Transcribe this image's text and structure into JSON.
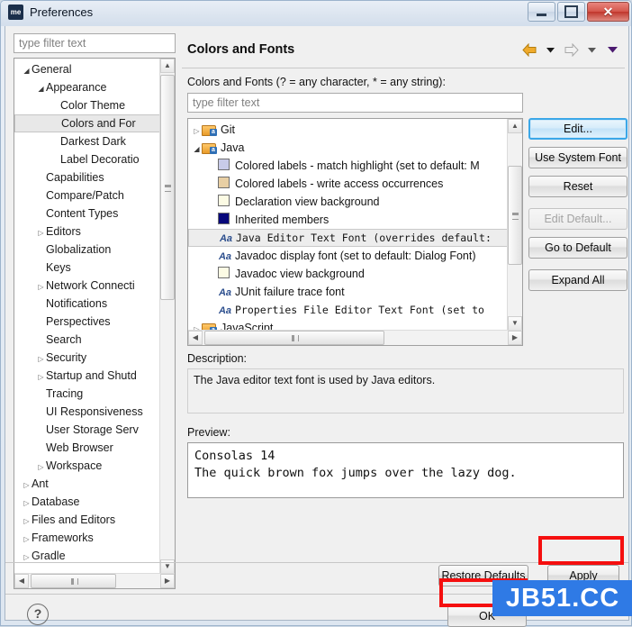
{
  "window": {
    "title": "Preferences",
    "app_icon_text": "me",
    "controls": {
      "minimize": "minimize-icon",
      "maximize": "maximize-icon",
      "close": "✕"
    }
  },
  "left": {
    "filter_placeholder": "type filter text",
    "tree": [
      {
        "label": "General",
        "indent": 0,
        "arrow": "open",
        "selected": false
      },
      {
        "label": "Appearance",
        "indent": 1,
        "arrow": "open",
        "selected": false
      },
      {
        "label": "Color Theme",
        "indent": 2,
        "arrow": "none",
        "selected": false
      },
      {
        "label": "Colors and For",
        "indent": 2,
        "arrow": "none",
        "selected": true
      },
      {
        "label": "Darkest Dark",
        "indent": 2,
        "arrow": "none",
        "selected": false
      },
      {
        "label": "Label Decoratio",
        "indent": 2,
        "arrow": "none",
        "selected": false
      },
      {
        "label": "Capabilities",
        "indent": 1,
        "arrow": "none",
        "selected": false
      },
      {
        "label": "Compare/Patch",
        "indent": 1,
        "arrow": "none",
        "selected": false
      },
      {
        "label": "Content Types",
        "indent": 1,
        "arrow": "none",
        "selected": false
      },
      {
        "label": "Editors",
        "indent": 1,
        "arrow": "closed",
        "selected": false
      },
      {
        "label": "Globalization",
        "indent": 1,
        "arrow": "none",
        "selected": false
      },
      {
        "label": "Keys",
        "indent": 1,
        "arrow": "none",
        "selected": false
      },
      {
        "label": "Network Connecti",
        "indent": 1,
        "arrow": "closed",
        "selected": false
      },
      {
        "label": "Notifications",
        "indent": 1,
        "arrow": "none",
        "selected": false
      },
      {
        "label": "Perspectives",
        "indent": 1,
        "arrow": "none",
        "selected": false
      },
      {
        "label": "Search",
        "indent": 1,
        "arrow": "none",
        "selected": false
      },
      {
        "label": "Security",
        "indent": 1,
        "arrow": "closed",
        "selected": false
      },
      {
        "label": "Startup and Shutd",
        "indent": 1,
        "arrow": "closed",
        "selected": false
      },
      {
        "label": "Tracing",
        "indent": 1,
        "arrow": "none",
        "selected": false
      },
      {
        "label": "UI Responsiveness",
        "indent": 1,
        "arrow": "none",
        "selected": false
      },
      {
        "label": "User Storage Serv",
        "indent": 1,
        "arrow": "none",
        "selected": false
      },
      {
        "label": "Web Browser",
        "indent": 1,
        "arrow": "none",
        "selected": false
      },
      {
        "label": "Workspace",
        "indent": 1,
        "arrow": "closed",
        "selected": false
      },
      {
        "label": "Ant",
        "indent": 0,
        "arrow": "closed",
        "selected": false
      },
      {
        "label": "Database",
        "indent": 0,
        "arrow": "closed",
        "selected": false
      },
      {
        "label": "Files and Editors",
        "indent": 0,
        "arrow": "closed",
        "selected": false
      },
      {
        "label": "Frameworks",
        "indent": 0,
        "arrow": "closed",
        "selected": false
      },
      {
        "label": "Gradle",
        "indent": 0,
        "arrow": "closed",
        "selected": false
      }
    ]
  },
  "page": {
    "title": "Colors and Fonts",
    "nav": {
      "back": "back-arrow-icon",
      "back_menu": "chevron-down-icon",
      "forward": "forward-arrow-icon",
      "forward_menu": "chevron-down-icon",
      "view_menu": "view-menu-icon"
    },
    "filter_label": "Colors and Fonts (? = any character, * = any string):",
    "filter_placeholder": "type filter text",
    "tree": [
      {
        "label": "Git",
        "kind": "folder",
        "indent": 0,
        "arrow": "closed",
        "selected": false
      },
      {
        "label": "Java",
        "kind": "folder",
        "indent": 0,
        "arrow": "open",
        "selected": false
      },
      {
        "label": "Colored labels - match highlight (set to default: M",
        "kind": "swatch",
        "color": "#c8cbe8",
        "indent": 1,
        "arrow": "none",
        "selected": false
      },
      {
        "label": "Colored labels - write access occurrences",
        "kind": "swatch",
        "color": "#e8cfa4",
        "indent": 1,
        "arrow": "none",
        "selected": false
      },
      {
        "label": "Declaration view background",
        "kind": "swatch",
        "color": "#fcfbe4",
        "indent": 1,
        "arrow": "none",
        "selected": false
      },
      {
        "label": "Inherited members",
        "kind": "swatch",
        "color": "#08087a",
        "indent": 1,
        "arrow": "none",
        "selected": false
      },
      {
        "label": "Java Editor Text Font (overrides default:",
        "kind": "font-mono",
        "indent": 1,
        "arrow": "none",
        "selected": true
      },
      {
        "label": "Javadoc display font (set to default: Dialog Font)",
        "kind": "font",
        "indent": 1,
        "arrow": "none",
        "selected": false
      },
      {
        "label": "Javadoc view background",
        "kind": "swatch",
        "color": "#fcfbe4",
        "indent": 1,
        "arrow": "none",
        "selected": false
      },
      {
        "label": "JUnit failure trace font",
        "kind": "font",
        "indent": 1,
        "arrow": "none",
        "selected": false
      },
      {
        "label": "Properties File Editor Text Font (set to",
        "kind": "font-mono",
        "indent": 1,
        "arrow": "none",
        "selected": false
      },
      {
        "label": "JavaScript",
        "kind": "folder",
        "indent": 0,
        "arrow": "closed",
        "selected": false
      }
    ],
    "buttons": [
      {
        "label": "Edit...",
        "state": "primary"
      },
      {
        "label": "Use System Font",
        "state": "normal"
      },
      {
        "label": "Reset",
        "state": "normal"
      },
      {
        "label": "Edit Default...",
        "state": "disabled"
      },
      {
        "label": "Go to Default",
        "state": "normal"
      },
      {
        "label": "Expand All",
        "state": "normal"
      }
    ],
    "description_label": "Description:",
    "description_text": "The Java editor text font is used by Java editors.",
    "preview_label": "Preview:",
    "preview_line1": "Consolas 14",
    "preview_line2": "The quick brown fox jumps over the lazy dog."
  },
  "footer": {
    "restore_defaults": "Restore Defaults",
    "apply": "Apply",
    "ok": "OK",
    "help": "?"
  },
  "overlay": {
    "watermark": "JB51.CC",
    "watermark_color": "#2f7ae5",
    "highlight_color": "#f50f0f"
  }
}
